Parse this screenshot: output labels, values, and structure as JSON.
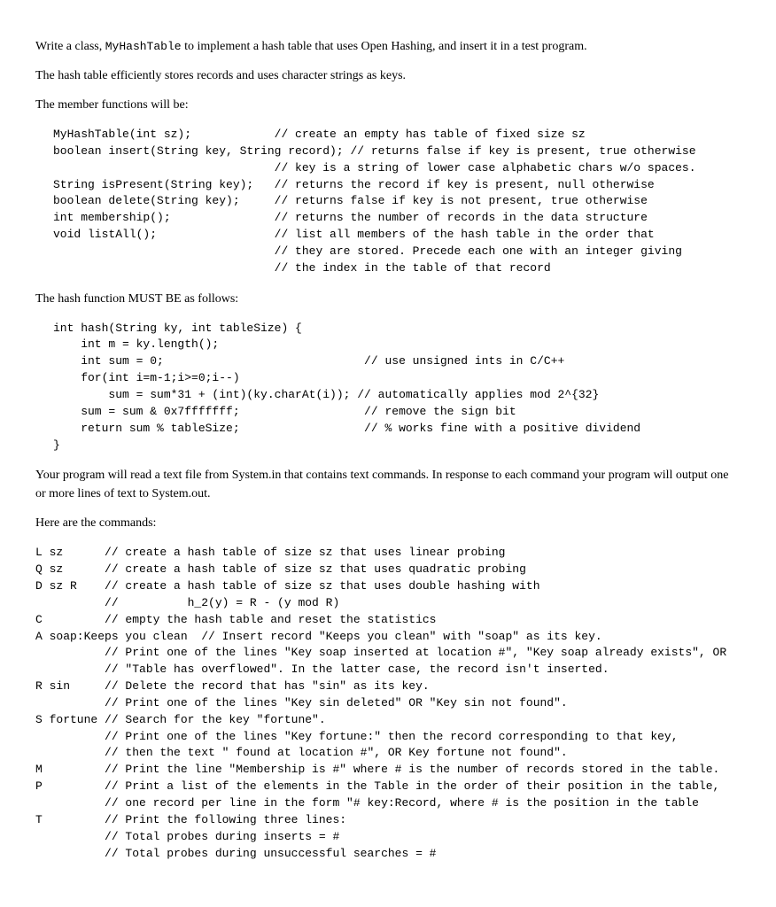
{
  "intro": {
    "p1_pre": "Write a class, ",
    "p1_code": "MyHashTable",
    "p1_post": " to implement a hash table that uses Open Hashing, and insert it in a test program.",
    "p2": "The hash table efficiently stores records and uses character strings as keys.",
    "p3": "The member functions will be:"
  },
  "member_functions": "MyHashTable(int sz);            // create an empty has table of fixed size sz\nboolean insert(String key, String record); // returns false if key is present, true otherwise\n                                // key is a string of lower case alphabetic chars w/o spaces.\nString isPresent(String key);   // returns the record if key is present, null otherwise\nboolean delete(String key);     // returns false if key is not present, true otherwise\nint membership();               // returns the number of records in the data structure\nvoid listAll();                 // list all members of the hash table in the order that\n                                // they are stored. Precede each one with an integer giving\n                                // the index in the table of that record",
  "hash_heading": "The hash function MUST BE as follows:",
  "hash_function": "int hash(String ky, int tableSize) {\n    int m = ky.length();\n    int sum = 0;                             // use unsigned ints in C/C++\n    for(int i=m-1;i>=0;i--)\n        sum = sum*31 + (int)(ky.charAt(i)); // automatically applies mod 2^{32}\n    sum = sum & 0x7fffffff;                  // remove the sign bit\n    return sum % tableSize;                  // % works fine with a positive dividend\n}",
  "program_desc": "Your program will read a text file from System.in that contains text commands. In response to each command your program will output one or more lines of text to System.out.",
  "commands_heading": "Here are the commands:",
  "commands": "L sz      // create a hash table of size sz that uses linear probing\nQ sz      // create a hash table of size sz that uses quadratic probing\nD sz R    // create a hash table of size sz that uses double hashing with\n          //          h_2(y) = R - (y mod R)\nC         // empty the hash table and reset the statistics\nA soap:Keeps you clean  // Insert record \"Keeps you clean\" with \"soap\" as its key.\n          // Print one of the lines \"Key soap inserted at location #\", \"Key soap already exists\", OR\n          // \"Table has overflowed\". In the latter case, the record isn't inserted.\nR sin     // Delete the record that has \"sin\" as its key.\n          // Print one of the lines \"Key sin deleted\" OR \"Key sin not found\".\nS fortune // Search for the key \"fortune\".\n          // Print one of the lines \"Key fortune:\" then the record corresponding to that key,\n          // then the text \" found at location #\", OR Key fortune not found\".\nM         // Print the line \"Membership is #\" where # is the number of records stored in the table.\nP         // Print a list of the elements in the Table in the order of their position in the table,\n          // one record per line in the form \"# key:Record, where # is the position in the table\nT         // Print the following three lines:\n          // Total probes during inserts = #\n          // Total probes during unsuccessful searches = #"
}
